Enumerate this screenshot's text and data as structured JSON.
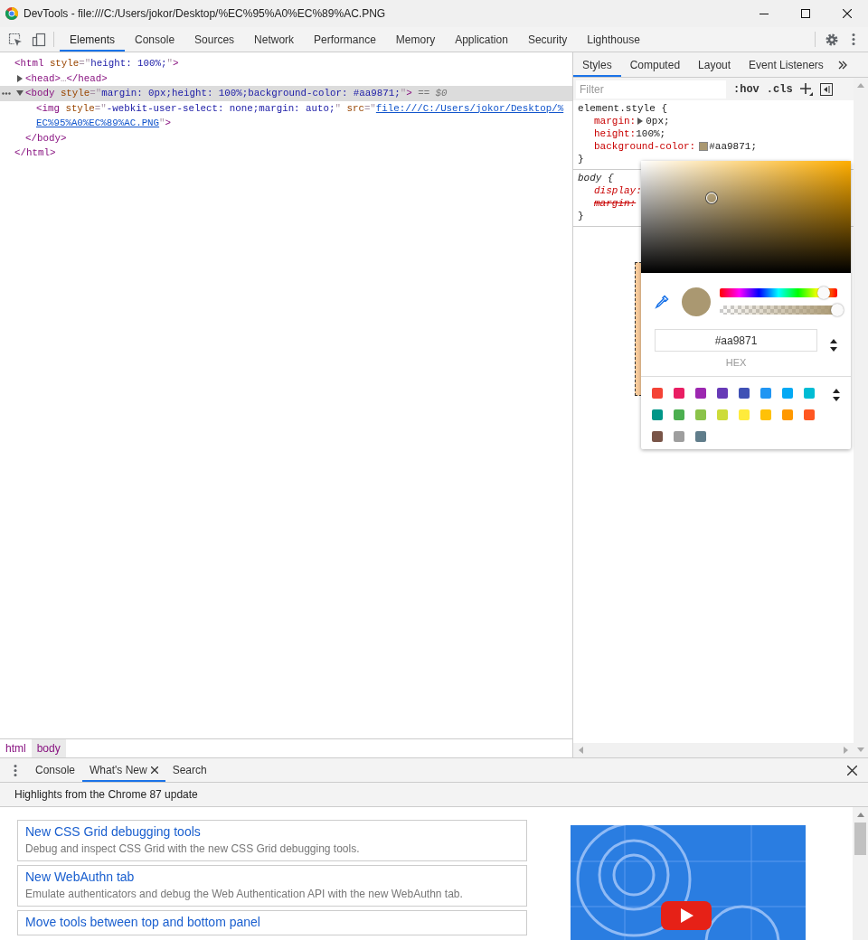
{
  "window": {
    "title": "DevTools - file:///C:/Users/jokor/Desktop/%EC%95%A0%EC%89%AC.PNG"
  },
  "main_tabs": [
    {
      "label": "Elements",
      "selected": true
    },
    {
      "label": "Console",
      "selected": false
    },
    {
      "label": "Sources",
      "selected": false
    },
    {
      "label": "Network",
      "selected": false
    },
    {
      "label": "Performance",
      "selected": false
    },
    {
      "label": "Memory",
      "selected": false
    },
    {
      "label": "Application",
      "selected": false
    },
    {
      "label": "Security",
      "selected": false
    },
    {
      "label": "Lighthouse",
      "selected": false
    }
  ],
  "elements_panel": {
    "nodes": [
      {
        "open": [
          {
            "kind": "tag",
            "text": "<html"
          },
          {
            "kind": "attr",
            "text": " style"
          },
          {
            "kind": "punct",
            "text": "=\""
          },
          {
            "kind": "value",
            "text": "height: 100%;"
          },
          {
            "kind": "punct",
            "text": "\""
          },
          {
            "kind": "tag",
            "text": ">"
          }
        ],
        "selected": false,
        "close": [
          {
            "kind": "tag",
            "text": "</html>"
          }
        ],
        "children": [
          {
            "open": [
              {
                "kind": "tag",
                "text": "<head>"
              },
              {
                "kind": "punct",
                "text": "…"
              },
              {
                "kind": "tag",
                "text": "</head>"
              }
            ],
            "expanded": false,
            "selected": false
          },
          {
            "open": [
              {
                "kind": "tag",
                "text": "<body"
              },
              {
                "kind": "attr",
                "text": " style"
              },
              {
                "kind": "punct",
                "text": "=\""
              },
              {
                "kind": "value",
                "text": "margin: 0px;height: 100%;background-color: #aa9871;"
              },
              {
                "kind": "punct",
                "text": "\""
              },
              {
                "kind": "tag",
                "text": ">"
              },
              {
                "kind": "hint",
                "text": " == $0"
              }
            ],
            "expanded": true,
            "selected": true,
            "close": [
              {
                "kind": "tag",
                "text": "</body>"
              }
            ],
            "children": [
              {
                "lines": [
                  [
                    {
                      "kind": "tag",
                      "text": "<img"
                    },
                    {
                      "kind": "attr",
                      "text": " style"
                    },
                    {
                      "kind": "punct",
                      "text": "=\""
                    },
                    {
                      "kind": "value",
                      "text": "-webkit-user-select: none;margin: auto;"
                    },
                    {
                      "kind": "punct",
                      "text": "\""
                    },
                    {
                      "kind": "attr",
                      "text": " src"
                    },
                    {
                      "kind": "punct",
                      "text": "=\""
                    },
                    {
                      "kind": "link",
                      "text": "file:///C:/Users/jokor/Desktop/%"
                    }
                  ],
                  [
                    {
                      "kind": "link",
                      "text": "EC%95%A0%EC%89%AC.PNG"
                    },
                    {
                      "kind": "punct",
                      "text": "\""
                    },
                    {
                      "kind": "tag",
                      "text": ">"
                    }
                  ]
                ],
                "selected": false
              }
            ]
          }
        ]
      }
    ]
  },
  "breadcrumbs": [
    {
      "label": "html",
      "selected": false
    },
    {
      "label": "body",
      "selected": true
    }
  ],
  "styles_panel": {
    "tabs": [
      {
        "label": "Styles",
        "selected": true
      },
      {
        "label": "Computed",
        "selected": false
      },
      {
        "label": "Layout",
        "selected": false
      },
      {
        "label": "Event Listeners",
        "selected": false
      }
    ],
    "filter": {
      "placeholder": "Filter"
    },
    "hov": ":hov",
    "cls": ".cls",
    "rules": [
      {
        "kind": "inline",
        "selector": "element.style {",
        "close": "}",
        "declarations": [
          {
            "name": "margin:",
            "value": "0px;",
            "expandable": true,
            "overridden": false
          },
          {
            "name": "height:",
            "value": "100%;",
            "overridden": false
          },
          {
            "name": "background-color:",
            "value": "#aa9871;",
            "color": "#aa9871",
            "overridden": false
          }
        ]
      },
      {
        "kind": "user-agent",
        "selector": "body {",
        "close": "}",
        "declarations": [
          {
            "name": "display:",
            "overridden": false
          },
          {
            "name": "margin:",
            "overridden": true
          }
        ]
      }
    ]
  },
  "color_picker": {
    "hex": "#aa9871",
    "format": "HEX",
    "hue_slider": {
      "level": 0.886
    },
    "alpha_slider": {
      "level": 1
    },
    "palette": [
      {
        "color": "#f44336"
      },
      {
        "color": "#e91e63"
      },
      {
        "color": "#9c27b0"
      },
      {
        "color": "#673ab7"
      },
      {
        "color": "#3f51b5"
      },
      {
        "color": "#2196f3"
      },
      {
        "color": "#03a9f4"
      },
      {
        "color": "#00bcd4"
      },
      {
        "color": "#009688"
      },
      {
        "color": "#4caf50"
      },
      {
        "color": "#8bc34a"
      },
      {
        "color": "#cddc39"
      },
      {
        "color": "#ffeb3b"
      },
      {
        "color": "#ffc107"
      },
      {
        "color": "#ff9800"
      },
      {
        "color": "#ff5722"
      },
      {
        "color": "#795548"
      },
      {
        "color": "#9e9e9e"
      },
      {
        "color": "#607d8b"
      }
    ]
  },
  "drawer": {
    "tabs": [
      {
        "label": "Console",
        "selected": false,
        "closable": false
      },
      {
        "label": "What's New",
        "selected": true,
        "closable": true
      },
      {
        "label": "Search",
        "selected": false,
        "closable": false
      }
    ],
    "header": "Highlights from the Chrome 87 update",
    "cards": [
      {
        "title": "New CSS Grid debugging tools",
        "description": "Debug and inspect CSS Grid with the new CSS Grid debugging tools."
      },
      {
        "title": "New WebAuthn tab",
        "description": "Emulate authenticators and debug the Web Authentication API with the new WebAuthn tab."
      },
      {
        "title": "Move tools between top and bottom panel"
      }
    ]
  }
}
